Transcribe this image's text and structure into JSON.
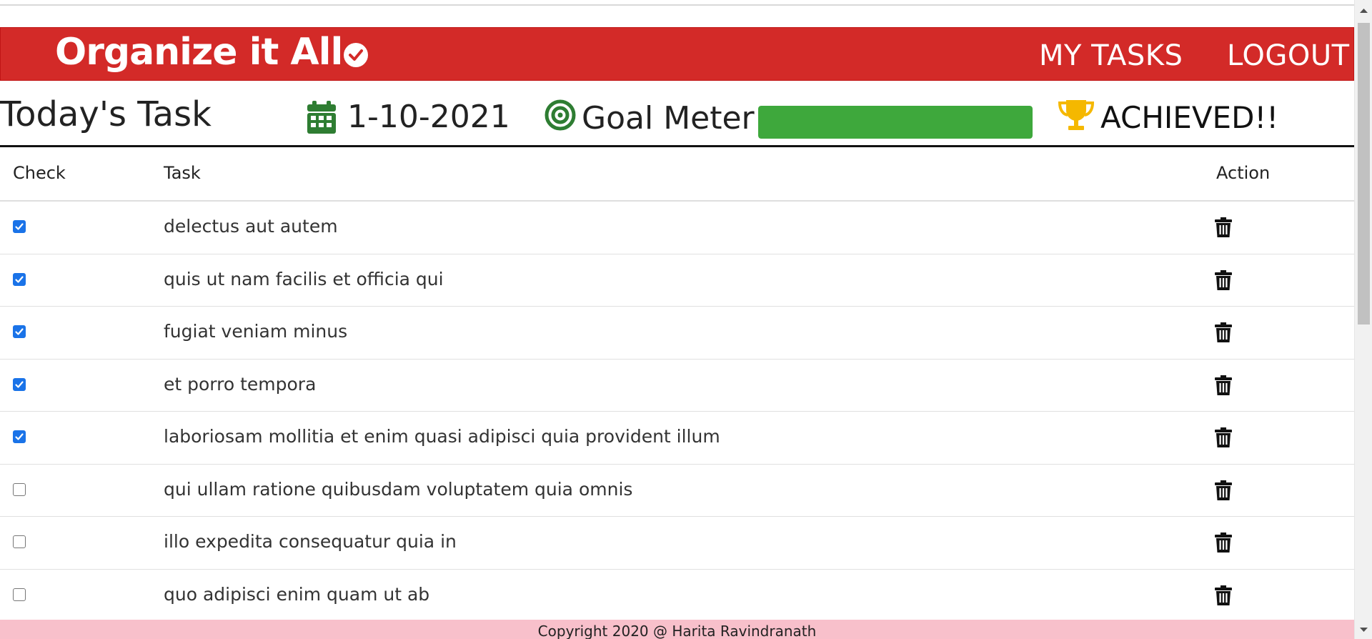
{
  "header": {
    "brand": "Organize it All",
    "nav": {
      "my_tasks": "MY TASKS",
      "logout": "LOGOUT"
    }
  },
  "infobar": {
    "title": "Today's Task",
    "date": "1-10-2021",
    "goal_label": "Goal Meter",
    "goal_progress": 1.0,
    "status": "ACHIEVED!!"
  },
  "table": {
    "columns": {
      "check": "Check",
      "task": "Task",
      "action": "Action"
    },
    "rows": [
      {
        "checked": true,
        "task": "delectus aut autem"
      },
      {
        "checked": true,
        "task": "quis ut nam facilis et officia qui"
      },
      {
        "checked": true,
        "task": "fugiat veniam minus"
      },
      {
        "checked": true,
        "task": "et porro tempora"
      },
      {
        "checked": true,
        "task": "laboriosam mollitia et enim quasi adipisci quia provident illum"
      },
      {
        "checked": false,
        "task": "qui ullam ratione quibusdam voluptatem quia omnis"
      },
      {
        "checked": false,
        "task": "illo expedita consequatur quia in"
      },
      {
        "checked": false,
        "task": "quo adipisci enim quam ut ab"
      }
    ]
  },
  "footer": {
    "text": "Copyright 2020 @ Harita Ravindranath"
  },
  "colors": {
    "navbar": "#d32a28",
    "meter": "#3ea83c",
    "calendar_icon": "#2e7d32",
    "target_icon": "#2e7d32",
    "trophy_icon": "#f5b800",
    "checkbox": "#1a73e8",
    "footer": "#f8c0cb"
  },
  "icons": {
    "brand": "check-circle-icon",
    "date": "calendar-icon",
    "goal": "target-icon",
    "status": "trophy-icon",
    "delete": "trash-icon"
  }
}
